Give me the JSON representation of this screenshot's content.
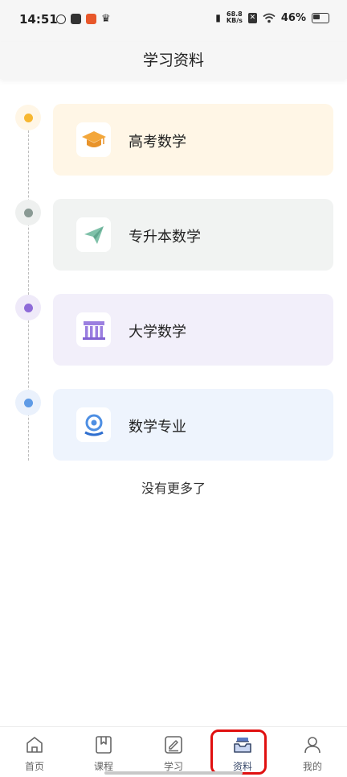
{
  "status_bar": {
    "time": "14:51",
    "net_speed_value": "68.8",
    "net_speed_unit": "KB/s",
    "battery": "46%"
  },
  "header": {
    "title": "学习资料"
  },
  "categories": [
    {
      "label": "高考数学",
      "bg_color": "#fff6e6",
      "dot_color": "#f7b731",
      "icon": "graduation-cap-icon"
    },
    {
      "label": "专升本数学",
      "bg_color": "#f1f3f2",
      "dot_color": "#8a9a94",
      "icon": "paper-plane-icon"
    },
    {
      "label": "大学数学",
      "bg_color": "#f2effa",
      "dot_color": "#8e6bd8",
      "icon": "university-building-icon"
    },
    {
      "label": "数学专业",
      "bg_color": "#eef4fd",
      "dot_color": "#5f9be6",
      "icon": "location-pin-icon"
    }
  ],
  "list_footer": "没有更多了",
  "tabbar": {
    "items": [
      {
        "label": "首页",
        "icon": "home-icon",
        "active": false
      },
      {
        "label": "课程",
        "icon": "bookmark-book-icon",
        "active": false
      },
      {
        "label": "学习",
        "icon": "edit-note-icon",
        "active": false
      },
      {
        "label": "资料",
        "icon": "inbox-tray-icon",
        "active": true
      },
      {
        "label": "我的",
        "icon": "user-icon",
        "active": false
      }
    ]
  },
  "colors": {
    "highlight": "#e01010",
    "active_tab": "#3a4a6b"
  }
}
